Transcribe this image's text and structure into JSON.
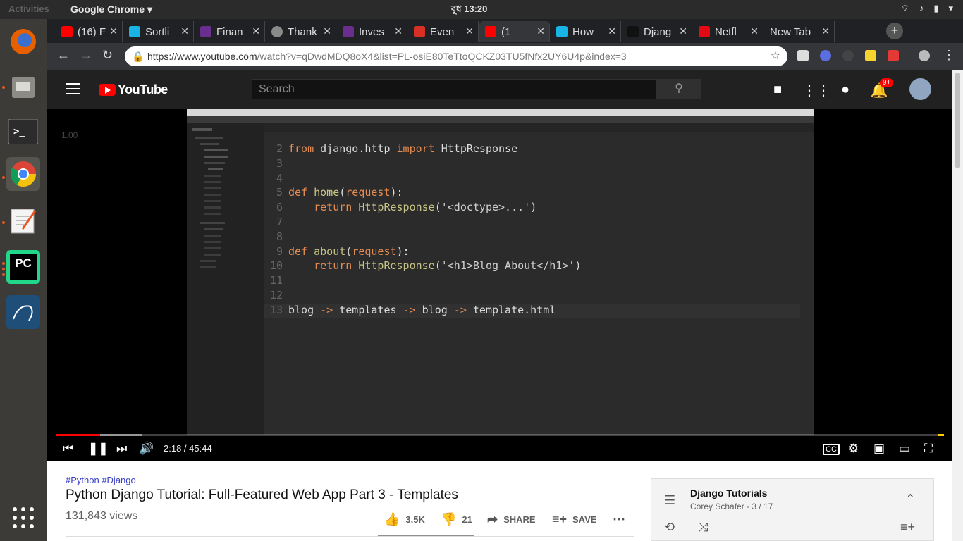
{
  "system": {
    "activities": "Activities",
    "app_menu": "Google Chrome ▾",
    "clock": "বুধ 13:20"
  },
  "dock": {
    "pycharm_label": "PC"
  },
  "tabs": [
    {
      "label": "(16) F",
      "fav_color": "#ff0000"
    },
    {
      "label": "Sortli",
      "fav_color": "#1ab3e6"
    },
    {
      "label": "Finan",
      "fav_color": "#6a2f8e"
    },
    {
      "label": "Thank",
      "fav_color": "#8a8a8a"
    },
    {
      "label": "Inves",
      "fav_color": "#6a2f8e"
    },
    {
      "label": "Even",
      "fav_color": "#d93025"
    },
    {
      "label": "(1",
      "fav_color": "#ff0000"
    },
    {
      "label": "How",
      "fav_color": "#1ab3e6"
    },
    {
      "label": "Djang",
      "fav_color": "#111111"
    },
    {
      "label": "Netfl",
      "fav_color": "#e50914"
    },
    {
      "label": "New Tab",
      "fav_color": "#202124"
    }
  ],
  "address": {
    "host": "https://www.youtube.com",
    "path": "/watch?v=qDwdMDQ8oX4&list=PL-osiE80TeTtoQCKZ03TU5fNfx2UY6U4p&index=3"
  },
  "youtube": {
    "logo": "YouTube",
    "search_placeholder": "Search",
    "notifications_badge": "9+"
  },
  "player": {
    "speed_overlay": "1.00",
    "time": "2:18 / 45:44",
    "progress_fraction": 0.05
  },
  "code_lines": [
    {
      "n": "2",
      "parts": [
        [
          "kw",
          "from"
        ],
        [
          "",
          " django.http "
        ],
        [
          "kw",
          "import"
        ],
        [
          "",
          " HttpResponse"
        ]
      ]
    },
    {
      "n": "3",
      "parts": []
    },
    {
      "n": "4",
      "parts": []
    },
    {
      "n": "5",
      "parts": [
        [
          "kw",
          "def"
        ],
        [
          "",
          " "
        ],
        [
          "fn",
          "home"
        ],
        [
          "",
          "("
        ],
        [
          "kw",
          "request"
        ],
        [
          "",
          "):"
        ]
      ]
    },
    {
      "n": "6",
      "parts": [
        [
          "",
          "    "
        ],
        [
          "kw",
          "return"
        ],
        [
          "",
          " "
        ],
        [
          "fn",
          "HttpResponse"
        ],
        [
          "",
          "("
        ],
        [
          "str",
          "'<doctype>...'"
        ],
        [
          "",
          ")"
        ]
      ]
    },
    {
      "n": "7",
      "parts": []
    },
    {
      "n": "8",
      "parts": []
    },
    {
      "n": "9",
      "parts": [
        [
          "kw",
          "def"
        ],
        [
          "",
          " "
        ],
        [
          "fn",
          "about"
        ],
        [
          "",
          "("
        ],
        [
          "kw",
          "request"
        ],
        [
          "",
          "):"
        ]
      ]
    },
    {
      "n": "10",
      "parts": [
        [
          "",
          "    "
        ],
        [
          "kw",
          "return"
        ],
        [
          "",
          " "
        ],
        [
          "fn",
          "HttpResponse"
        ],
        [
          "",
          "("
        ],
        [
          "str",
          "'<h1>Blog About</h1>'"
        ],
        [
          "",
          ")"
        ]
      ]
    },
    {
      "n": "11",
      "parts": []
    },
    {
      "n": "12",
      "parts": []
    },
    {
      "n": "13",
      "parts": [
        [
          "",
          "blog "
        ],
        [
          "kw",
          "->"
        ],
        [
          "",
          " templates "
        ],
        [
          "kw",
          "->"
        ],
        [
          "",
          " blog "
        ],
        [
          "kw",
          "->"
        ],
        [
          "",
          " template.html"
        ]
      ]
    }
  ],
  "video": {
    "tags": "#Python #Django",
    "title": "Python Django Tutorial: Full-Featured Web App Part 3 - Templates",
    "views": "131,843 views",
    "likes": "3.5K",
    "dislikes": "21",
    "share": "SHARE",
    "save": "SAVE"
  },
  "playlist": {
    "title": "Django Tutorials",
    "subtitle": "Corey Schafer - 3 / 17"
  }
}
